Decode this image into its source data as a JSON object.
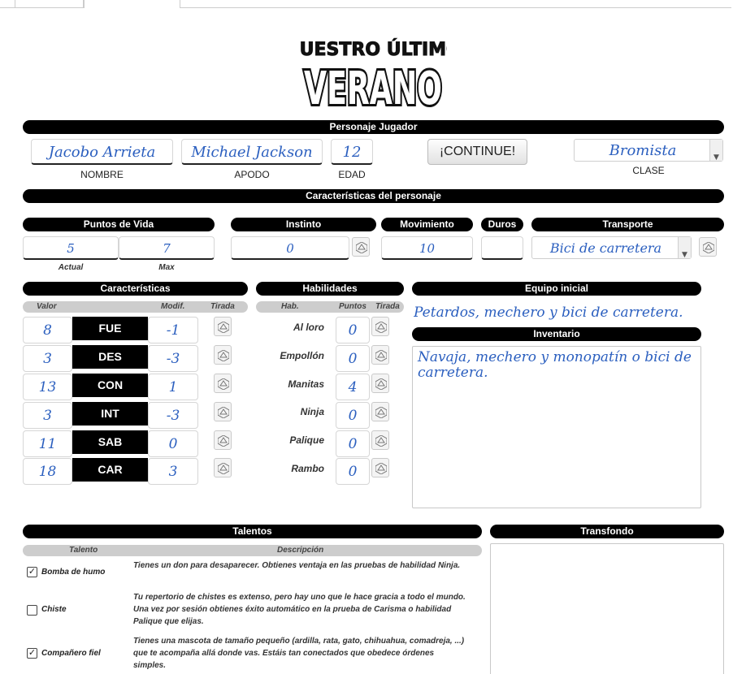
{
  "logo": {
    "line1": "NUESTRO ÚLTIMO",
    "line2": "VERANO"
  },
  "sections": {
    "player": "Personaje Jugador",
    "traits": "Características del personaje",
    "hp": "Puntos de Vida",
    "instinct": "Instinto",
    "movement": "Movimiento",
    "duros": "Duros",
    "transport": "Transporte",
    "characteristics": "Características",
    "skills": "Habilidades",
    "equipment": "Equipo inicial",
    "inventory": "Inventario",
    "talents": "Talentos",
    "background": "Transfondo"
  },
  "player": {
    "name": "Jacobo Arrieta",
    "nickname": "Michael Jackson",
    "age": "12",
    "class": "Bromista",
    "labels": {
      "name": "NOMBRE",
      "nickname": "APODO",
      "age": "EDAD",
      "class": "CLASE"
    },
    "continue_button": "¡CONTINUE!"
  },
  "stats": {
    "hp_current": "5",
    "hp_max": "7",
    "hp_current_label": "Actual",
    "hp_max_label": "Max",
    "instinct": "0",
    "movement": "10",
    "duros": "",
    "transport": "Bici de carretera"
  },
  "char_headers": {
    "value": "Valor",
    "modifier": "Modif.",
    "roll": "Tirada"
  },
  "characteristics": [
    {
      "value": "8",
      "name": "FUE",
      "mod": "-1"
    },
    {
      "value": "3",
      "name": "DES",
      "mod": "-3"
    },
    {
      "value": "13",
      "name": "CON",
      "mod": "1"
    },
    {
      "value": "3",
      "name": "INT",
      "mod": "-3"
    },
    {
      "value": "11",
      "name": "SAB",
      "mod": "0"
    },
    {
      "value": "18",
      "name": "CAR",
      "mod": "3"
    }
  ],
  "skill_headers": {
    "skill": "Hab.",
    "points": "Puntos",
    "roll": "Tirada"
  },
  "skills": [
    {
      "name": "Al loro",
      "points": "0"
    },
    {
      "name": "Empollón",
      "points": "0"
    },
    {
      "name": "Manitas",
      "points": "4"
    },
    {
      "name": "Ninja",
      "points": "0"
    },
    {
      "name": "Palique",
      "points": "0"
    },
    {
      "name": "Rambo",
      "points": "0"
    }
  ],
  "equipment": "Petardos, mechero y bici de carretera.",
  "inventory": "Navaja, mechero y monopatín o bici de carretera.",
  "talent_headers": {
    "talent": "Talento",
    "description": "Descripción"
  },
  "talents": [
    {
      "checked": true,
      "name": "Bomba de humo",
      "desc": "Tienes un don para desaparecer. Obtienes ventaja en las pruebas de habilidad Ninja."
    },
    {
      "checked": false,
      "name": "Chiste",
      "desc": "Tu repertorio de chistes es extenso, pero hay uno que le hace gracia a todo el mundo. Una vez por sesión obtienes éxito automático en la prueba de Carisma o habilidad Palique que elijas."
    },
    {
      "checked": true,
      "name": "Compañero fiel",
      "desc": "Tienes una mascota de tamaño pequeño (ardilla, rata, gato, chihuahua, comadreja, ...) que te acompaña allá donde vas. Estáis tan conectados que obedece órdenes simples."
    }
  ],
  "background_text": "",
  "icons": {
    "roll": "dice-icon",
    "dropdown": "chevron-down-icon",
    "check": "checkmark-icon"
  }
}
